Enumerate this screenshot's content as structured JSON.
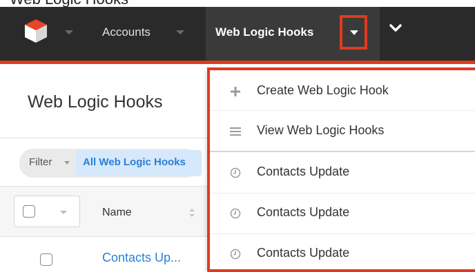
{
  "header_caption": "Web Logic Hooks",
  "nav": {
    "logo_icon": "sugarcube-logo-icon",
    "modules": [
      {
        "label": "Accounts"
      },
      {
        "label": "Web Logic Hooks"
      }
    ],
    "more_icon": "chevron-down-icon"
  },
  "page": {
    "title": "Web Logic Hooks",
    "filter": {
      "label": "Filter",
      "active": "All Web Logic Hooks"
    },
    "table": {
      "columns": [
        "Name"
      ],
      "rows": [
        {
          "name": "Contacts Up..."
        }
      ]
    }
  },
  "dropdown": {
    "items": [
      {
        "icon": "plus-icon",
        "label": "Create Web Logic Hook"
      },
      {
        "icon": "list-icon",
        "label": "View Web Logic Hooks"
      },
      {
        "icon": "clock-icon",
        "label": "Contacts Update"
      },
      {
        "icon": "clock-icon",
        "label": "Contacts Update"
      },
      {
        "icon": "clock-icon",
        "label": "Contacts Update"
      }
    ]
  },
  "colors": {
    "highlight_red": "#e03a1e",
    "nav_bg": "#2a2a2a",
    "link_blue": "#2a7fd6"
  }
}
